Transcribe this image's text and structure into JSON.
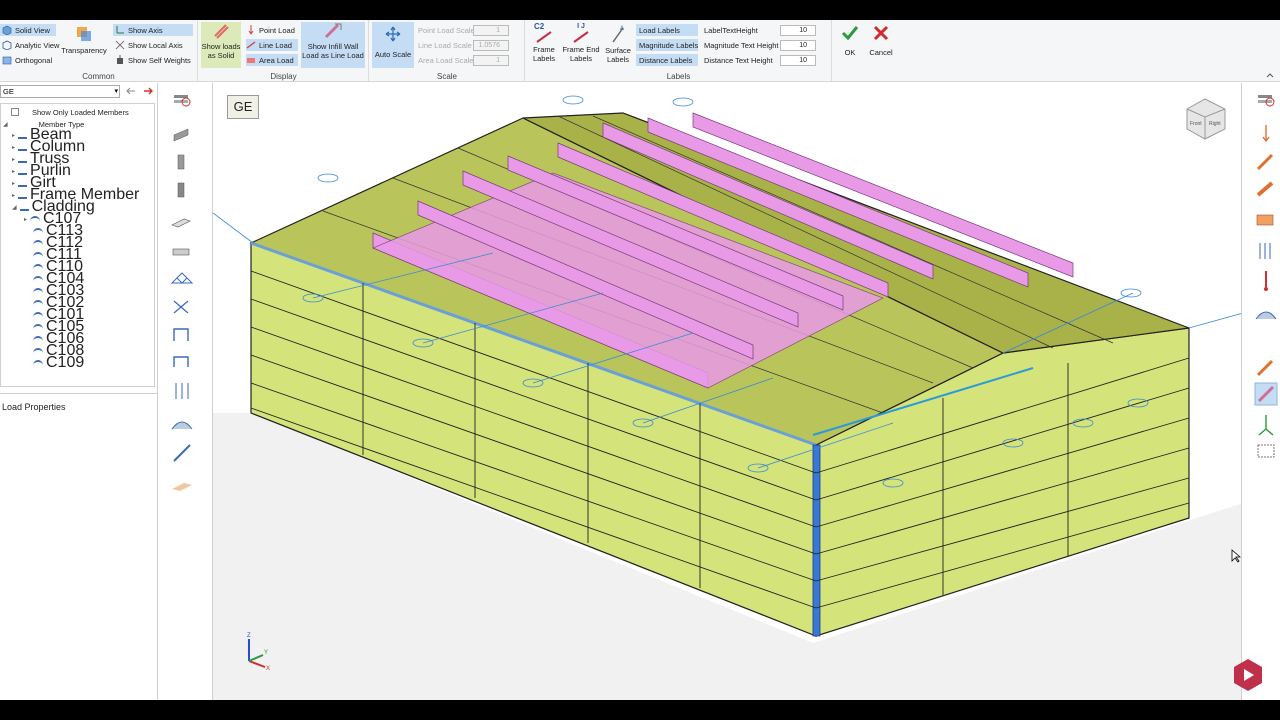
{
  "ribbon": {
    "common": {
      "label": "Common",
      "solid_view": "Solid View",
      "analytic_view": "Analytic View",
      "orthogonal": "Orthogonal",
      "transparency": "Transparency",
      "show_axis": "Show Axis",
      "show_local_axis": "Show Local Axis",
      "show_self_weights": "Show Self Weights"
    },
    "display": {
      "label": "Display",
      "show_loads_line1": "Show loads",
      "show_loads_line2": "as Solid",
      "point_load": "Point Load",
      "line_load": "Line Load",
      "area_load": "Area Load",
      "show_infill_line1": "Show Infill Wall",
      "show_infill_line2": "Load as Line Load"
    },
    "scale": {
      "label": "Scale",
      "auto_scale": "Auto Scale",
      "point_load_scale": "Point Load Scale",
      "point_load_scale_value": "1",
      "line_load_scale": "Line Load Scale",
      "line_load_scale_value": "1.0576",
      "area_load_scale": "Area Load Scale",
      "area_load_scale_value": "1"
    },
    "labels": {
      "label": "Labels",
      "frame_labels_line1": "Frame",
      "frame_labels_line2": "Labels",
      "frame_end_labels_line1": "Frame End",
      "frame_end_labels_line2": "Labels",
      "surface_labels_line1": "Surface",
      "surface_labels_line2": "Labels",
      "load_labels": "Load Labels",
      "magnitude_labels": "Magnitude Labels",
      "distance_labels": "Distance Labels",
      "label_text_height": "LabelTextHeight",
      "label_text_height_value": "10",
      "magnitude_text_height": "Magnitude Text Height",
      "magnitude_text_height_value": "10",
      "distance_text_height": "Distance Text Height",
      "distance_text_height_value": "10",
      "icon_c2": "C2",
      "icon_ij": "I J"
    },
    "ok": "OK",
    "cancel": "Cancel"
  },
  "left_panel": {
    "combo_value": "GE",
    "show_only_loaded": "Show Only Loaded Members",
    "member_type": "Member Type",
    "tree": [
      "Beam",
      "Column",
      "Truss",
      "Purlin",
      "Girt",
      "Frame Member",
      "Cladding"
    ],
    "cladding_items": [
      "C107",
      "C113",
      "C112",
      "C111",
      "C110",
      "C104",
      "C103",
      "C102",
      "C101",
      "C105",
      "C106",
      "C108",
      "C109"
    ],
    "load_properties": "Load Properties"
  },
  "viewport": {
    "view_label": "GE",
    "cube_front": "Front",
    "cube_right": "Right",
    "axis_z": "Z",
    "axis_x": "X",
    "axis_y": "Y"
  },
  "colors": {
    "ribbon_bg": "#f5f6f7",
    "selected": "#c5dcf5",
    "cladding": "#d4e37a",
    "roof": "#b9c45a",
    "load_patch": "#e99ae6",
    "column_blue": "#3a78d4"
  }
}
